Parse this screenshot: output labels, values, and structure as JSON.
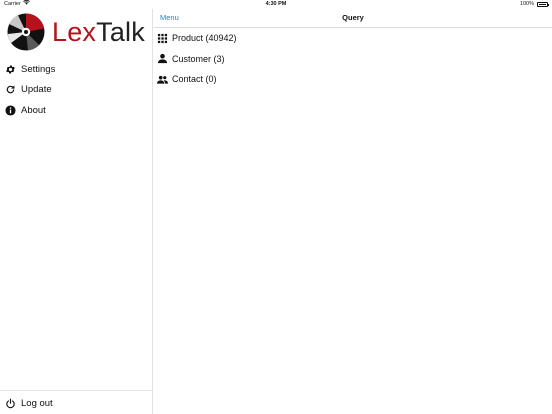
{
  "status_bar": {
    "carrier": "Carrier",
    "time": "4:30 PM",
    "battery": "100%"
  },
  "sidebar": {
    "logo": {
      "lex": "Lex",
      "talk": "Talk"
    },
    "items": [
      {
        "label": "Settings",
        "icon": "gear-icon"
      },
      {
        "label": "Update",
        "icon": "refresh-icon"
      },
      {
        "label": "About",
        "icon": "info-icon"
      }
    ],
    "logout": {
      "label": "Log out",
      "icon": "power-icon"
    }
  },
  "navbar": {
    "menu_label": "Menu",
    "title": "Query"
  },
  "query_list": [
    {
      "label": "Product (40942)",
      "icon": "grid-icon"
    },
    {
      "label": "Customer (3)",
      "icon": "person-icon"
    },
    {
      "label": "Contact (0)",
      "icon": "people-icon"
    }
  ],
  "colors": {
    "brand_red": "#b5121b",
    "link_blue": "#1a82d6"
  }
}
